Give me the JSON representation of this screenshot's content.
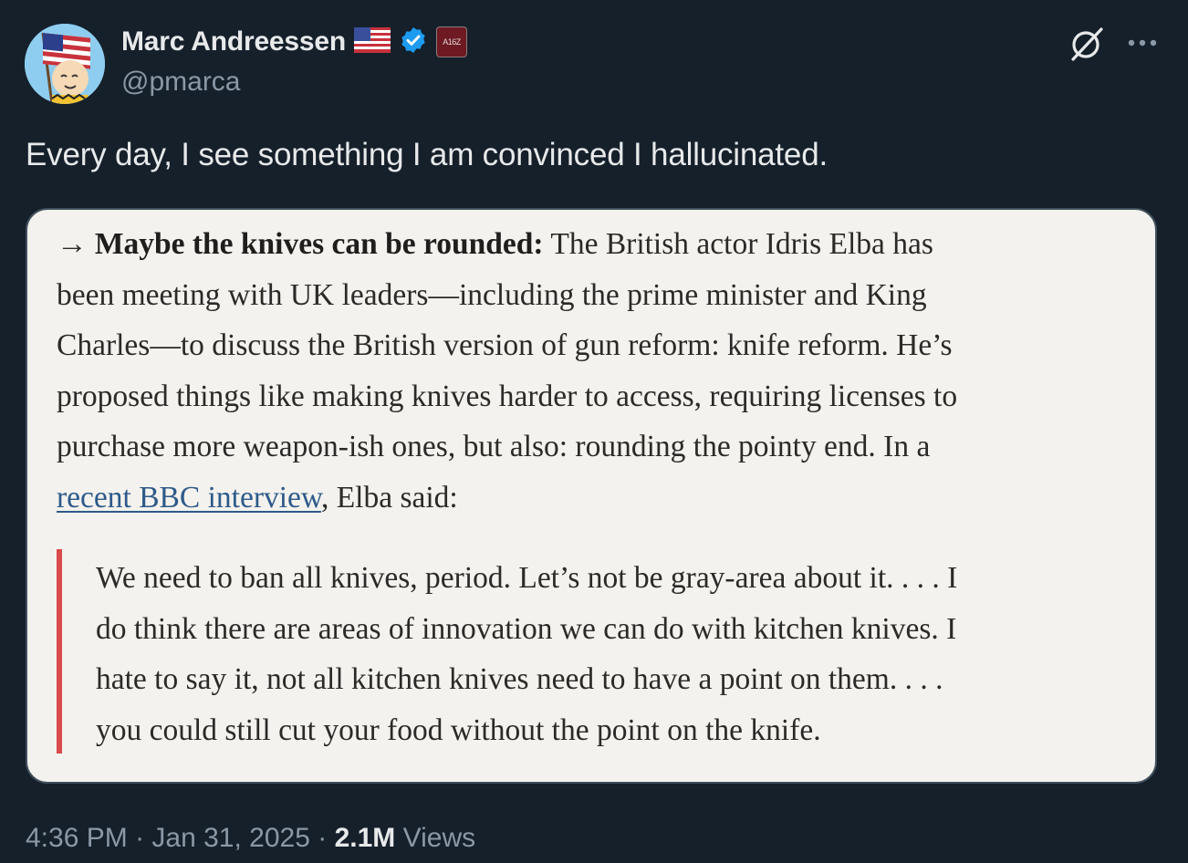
{
  "author": {
    "name": "Marc Andreessen",
    "handle": "@pmarca",
    "badge_text": "A16Z",
    "flag_icon": "us-flag-icon",
    "verified_icon": "verified-badge-icon",
    "verified_color": "#1d9bf0"
  },
  "actions": {
    "grok_icon": "grok-icon",
    "more_icon": "more-icon"
  },
  "tweet": {
    "text": "Every day, I see something I am convinced I hallucinated."
  },
  "image": {
    "heading": "Maybe the knives can be rounded:",
    "paragraph_lines": [
      "The British actor Idris Elba has",
      "been meeting with UK leaders—including the prime minister and King",
      "Charles—to discuss the British version of gun reform: knife reform. He’s",
      "proposed things like making knives harder to access, requiring licenses to",
      "purchase more weapon-ish ones, but also: rounding the pointy end. In a"
    ],
    "link_text": "recent BBC interview",
    "after_link": ", Elba said:",
    "quote_lines": [
      "We need to ban all knives, period. Let’s not be gray-area about it. . . . I",
      "do think there are areas of innovation we can do with kitchen knives. I",
      "hate to say it, not all kitchen knives need to have a point on them. . . .",
      "you could still cut your food without the point on the knife."
    ],
    "quote_bar_color": "#d94a4a"
  },
  "meta": {
    "time": "4:36 PM",
    "date": "Jan 31, 2025",
    "views_count": "2.1M",
    "views_label": "Views"
  }
}
